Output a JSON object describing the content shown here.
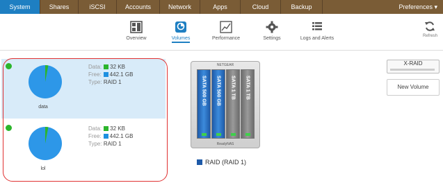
{
  "nav": {
    "tabs": [
      {
        "label": "System",
        "active": true
      },
      {
        "label": "Shares"
      },
      {
        "label": "iSCSI"
      },
      {
        "label": "Accounts"
      },
      {
        "label": "Network"
      },
      {
        "label": "Apps"
      },
      {
        "label": "Cloud"
      },
      {
        "label": "Backup"
      }
    ],
    "preferences": "Preferences ▾"
  },
  "toolbar": {
    "overview": "Overview",
    "volumes": "Volumes",
    "performance": "Performance",
    "settings": "Settings",
    "logs": "Logs and Alerts",
    "refresh": "Refresh"
  },
  "volumes": [
    {
      "name": "data",
      "data_label": "Data:",
      "data_value": "32 KB",
      "free_label": "Free:",
      "free_value": "442.1 GB",
      "type_label": "Type:",
      "type_value": "RAID 1",
      "used_fraction": 0.03
    },
    {
      "name": "lol",
      "data_label": "Data:",
      "data_value": "32 KB",
      "free_label": "Free:",
      "free_value": "442.1 GB",
      "type_label": "Type:",
      "type_value": "RAID 1",
      "used_fraction": 0.03
    }
  ],
  "chassis": {
    "brand": "NETGEAR",
    "model": "ReadyNAS",
    "disks": [
      {
        "label": "SATA 500 GB",
        "state": "active"
      },
      {
        "label": "SATA 500 GB",
        "state": "active"
      },
      {
        "label": "SATA 1 TB",
        "state": "spare"
      },
      {
        "label": "SATA 1 TB",
        "state": "spare"
      }
    ]
  },
  "raid_legend": "RAID (RAID 1)",
  "side": {
    "xraid": "X-RAID",
    "new_volume": "New Volume"
  },
  "colors": {
    "nav_bg": "#7a5c36",
    "accent": "#1e7fc2",
    "data_green": "#2cb52c",
    "free_blue": "#1e90e0",
    "pie_blue": "#2d97e8",
    "selection": "#d8ebf9"
  }
}
